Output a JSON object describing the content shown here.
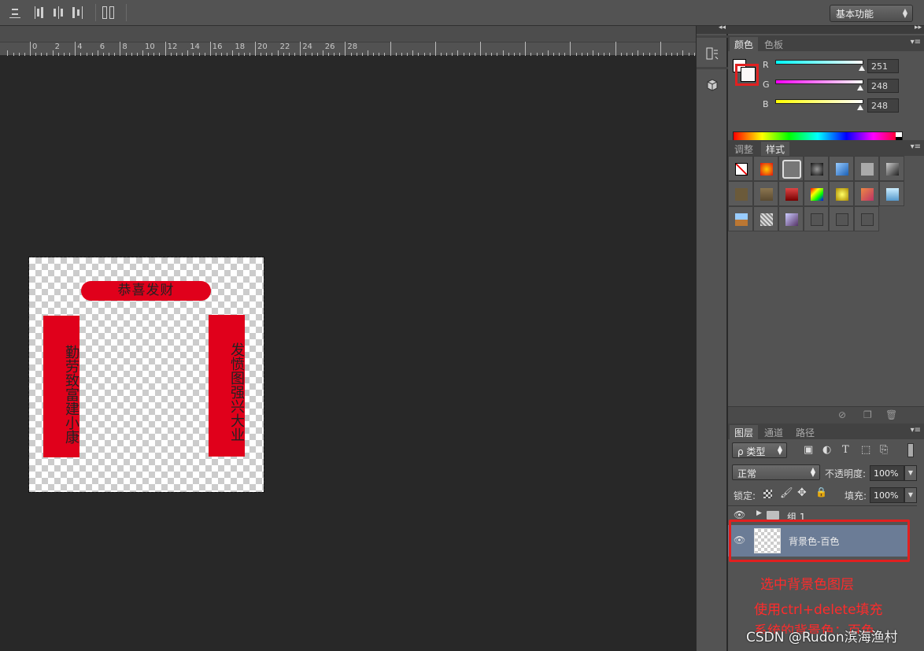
{
  "options_bar": {
    "align_icons": [
      "align-top-edges-icon",
      "align-vertical-centers-icon",
      "align-left-edges-icon",
      "distribute-vertical-icon",
      "distribute-horizontal-icon"
    ],
    "workspace": "基本功能"
  },
  "ruler": {
    "marks": [
      "0",
      "2",
      "4",
      "6",
      "8",
      "10",
      "12",
      "14",
      "16",
      "18",
      "20",
      "22",
      "24",
      "26",
      "28"
    ]
  },
  "document": {
    "top_banner": "恭喜发财",
    "left_banner": "勤劳致富建小康",
    "right_banner": "发愤图强兴大业",
    "accent_color": "#e0001b"
  },
  "color_panel": {
    "tabs": [
      "颜色",
      "色板"
    ],
    "channels": [
      {
        "label": "R",
        "value": "251"
      },
      {
        "label": "G",
        "value": "248"
      },
      {
        "label": "B",
        "value": "248"
      }
    ]
  },
  "styles_panel": {
    "tabs": [
      "调整",
      "样式"
    ]
  },
  "layers_panel": {
    "tabs": [
      "图层",
      "通道",
      "路径"
    ],
    "filter": "ρ 类型",
    "blend_mode": "正常",
    "opacity_label": "不透明度:",
    "opacity": "100%",
    "lock_label": "锁定:",
    "fill_label": "填充:",
    "fill": "100%",
    "layers": [
      {
        "name": "组 1",
        "type": "group",
        "visible": true
      },
      {
        "name": "背景色-百色",
        "type": "layer",
        "visible": true,
        "selected": true
      }
    ]
  },
  "annotations": {
    "line1": "选中背景色图层",
    "line2": "使用ctrl+delete填充",
    "line3": "系统的背景色：百色"
  },
  "watermark": "CSDN @Rudon滨海渔村",
  "highlight_color": "#e12020"
}
